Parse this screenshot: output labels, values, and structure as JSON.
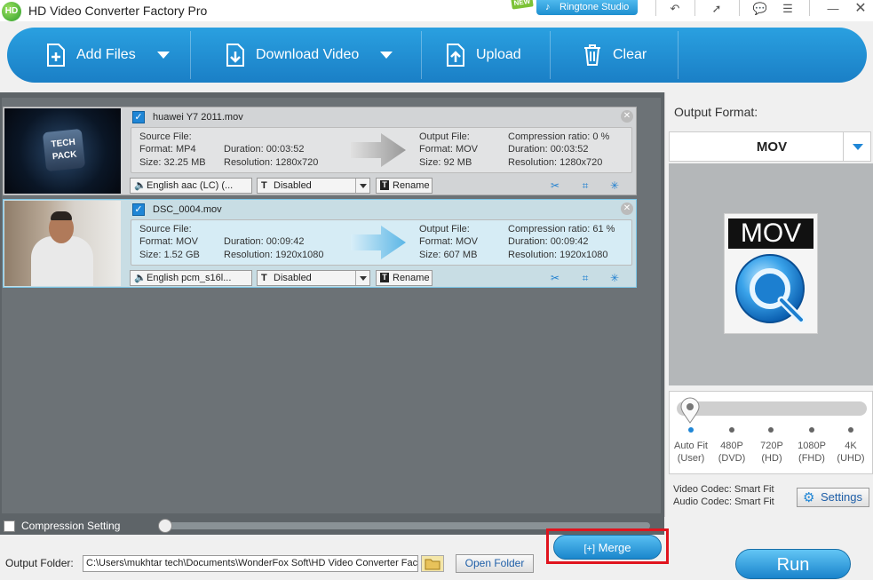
{
  "window": {
    "logo_text": "HD",
    "title": "HD Video Converter Factory Pro"
  },
  "topbar": {
    "new_badge": "NEW",
    "ringtone_label": "Ringtone Studio"
  },
  "toolbar": {
    "add_files": "Add Files",
    "download_video": "Download Video",
    "upload": "Upload",
    "clear": "Clear"
  },
  "files": [
    {
      "name": "huawei Y7 2011.mov",
      "source_label": "Source File:",
      "source_format": "Format: MP4",
      "source_duration": "Duration: 00:03:52",
      "source_size": "Size: 32.25 MB",
      "source_resolution": "Resolution: 1280x720",
      "output_label": "Output File:",
      "output_format": "Format: MOV",
      "output_duration": "Duration: 00:03:52",
      "output_size": "Size: 92 MB",
      "output_resolution": "Resolution: 1280x720",
      "compression": "Compression ratio: 0 %",
      "audio": "English aac (LC) (...",
      "subtitle": "Disabled",
      "rename": "Rename",
      "thumb_text": "TECH\nPACK"
    },
    {
      "name": "DSC_0004.mov",
      "source_label": "Source File:",
      "source_format": "Format: MOV",
      "source_duration": "Duration: 00:09:42",
      "source_size": "Size: 1.52 GB",
      "source_resolution": "Resolution: 1920x1080",
      "output_label": "Output File:",
      "output_format": "Format: MOV",
      "output_duration": "Duration: 00:09:42",
      "output_size": "Size: 607 MB",
      "output_resolution": "Resolution: 1920x1080",
      "compression": "Compression ratio: 61 %",
      "audio": "English pcm_s16l...",
      "subtitle": "Disabled",
      "rename": "Rename"
    }
  ],
  "compression": {
    "label": "Compression Setting"
  },
  "output": {
    "folder_label": "Output Folder:",
    "folder_path": "C:\\Users\\mukhtar tech\\Documents\\WonderFox Soft\\HD Video Converter Fac",
    "open_folder": "Open Folder"
  },
  "merge": {
    "label": "Merge"
  },
  "run": {
    "label": "Run"
  },
  "right_panel": {
    "title": "Output Format:",
    "format": "MOV",
    "badge_text": "MOV",
    "quality_options": [
      {
        "line1": "Auto Fit",
        "line2": "(User)"
      },
      {
        "line1": "480P",
        "line2": "(DVD)"
      },
      {
        "line1": "720P",
        "line2": "(HD)"
      },
      {
        "line1": "1080P",
        "line2": "(FHD)"
      },
      {
        "line1": "4K",
        "line2": "(UHD)"
      }
    ],
    "video_codec": "Video Codec: Smart Fit",
    "audio_codec": "Audio Codec: Smart Fit",
    "settings": "Settings"
  },
  "colors": {
    "accent": "#1f86d6",
    "toolbar": "#1a7fc6",
    "merge_highlight": "#e0141e"
  }
}
